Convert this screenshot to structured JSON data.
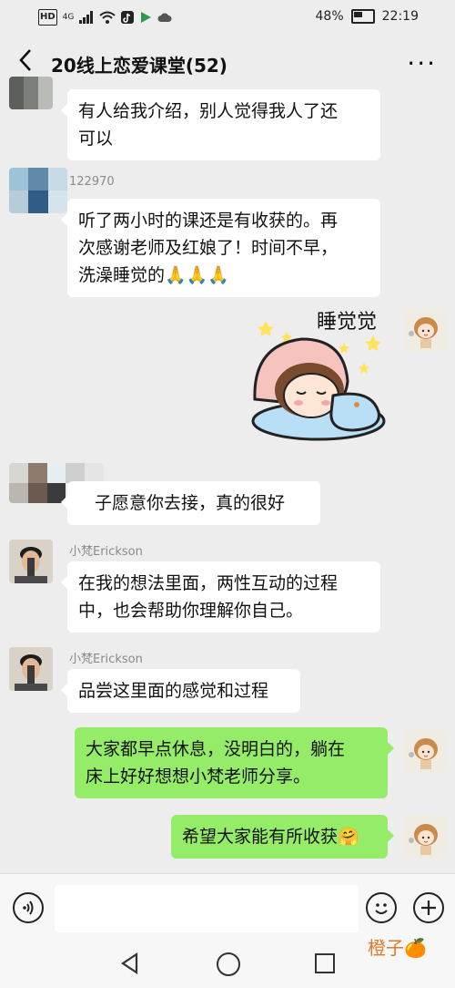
{
  "status_bar": {
    "left_icons": [
      "HD",
      "4G",
      "signal-icon",
      "wifi-icon",
      "tiktok-icon",
      "play-icon",
      "cloud-icon"
    ],
    "hd": "HD",
    "network": "4G",
    "battery": "48%",
    "time": "22:19"
  },
  "header": {
    "title": "20线上恋爱课堂(52)",
    "back_icon": "chevron-left-icon",
    "more_icon": "more-icon",
    "more_label": "···"
  },
  "messages": [
    {
      "side": "left",
      "sender": "",
      "text_lines": [
        "有人给我介绍，别人觉得我人了还",
        "可以"
      ]
    },
    {
      "side": "left",
      "sender": "122970",
      "text_lines": [
        "听了两小时的课还是有收获的。再",
        "次感谢老师及红娘了！时间不早，",
        "洗澡睡觉的🙏🙏🙏"
      ]
    },
    {
      "side": "right",
      "sticker_text": "睡觉觉"
    },
    {
      "side": "left",
      "sender": "",
      "text_lines": [
        "子愿意你去接，真的很好"
      ]
    },
    {
      "side": "left",
      "sender": "小梵Erickson",
      "text_lines": [
        "在我的想法里面，两性互动的过程",
        "中，也会帮助你理解你自己。"
      ]
    },
    {
      "side": "left",
      "sender": "小梵Erickson",
      "text_lines": [
        "品尝这里面的感觉和过程"
      ]
    },
    {
      "side": "right",
      "text_lines": [
        "大家都早点休息，没明白的，躺在",
        "床上好好想想小梵老师分享。"
      ]
    },
    {
      "side": "right",
      "text_lines": [
        "希望大家能有所收获🤗"
      ]
    }
  ],
  "input_bar": {
    "voice_icon": "voice-icon",
    "emoji_icon": "emoji-icon",
    "plus_icon": "plus-icon",
    "placeholder": ""
  },
  "watermark": "橙子🍊",
  "colors": {
    "background": "#ededed",
    "bubble_self": "#95ec69",
    "bubble_other": "#ffffff"
  }
}
